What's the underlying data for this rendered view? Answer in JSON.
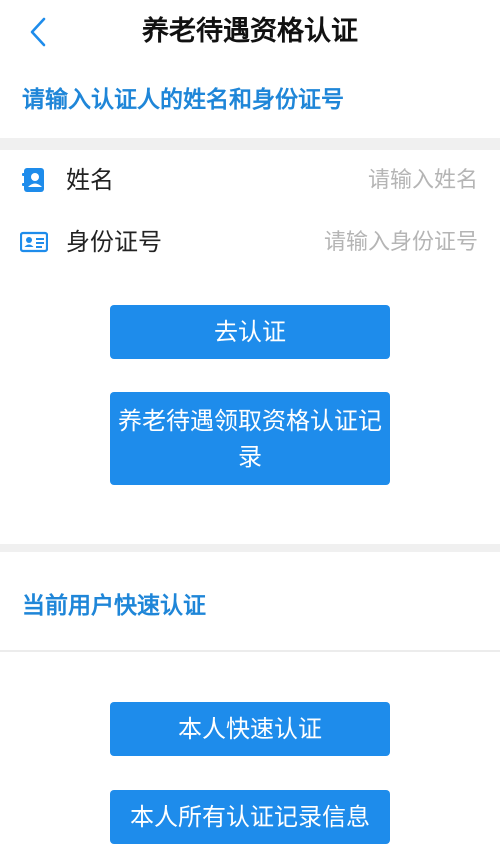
{
  "header": {
    "title": "养老待遇资格认证"
  },
  "section1": {
    "title": "请输入认证人的姓名和身份证号",
    "name_label": "姓名",
    "name_placeholder": "请输入姓名",
    "id_label": "身份证号",
    "id_placeholder": "请输入身份证号"
  },
  "buttons": {
    "verify": "去认证",
    "records": "养老待遇领取资格认证记录"
  },
  "section2": {
    "title": "当前用户快速认证",
    "quick_verify": "本人快速认证",
    "all_records": "本人所有认证记录信息"
  },
  "colors": {
    "accent": "#1e8ceb",
    "section_title": "#1f86d8",
    "placeholder": "#b5b5b5",
    "separator": "#f0f0f0"
  },
  "icons": {
    "back": "chevron-left-icon",
    "name": "contact-book-icon",
    "id_card": "id-card-icon"
  }
}
